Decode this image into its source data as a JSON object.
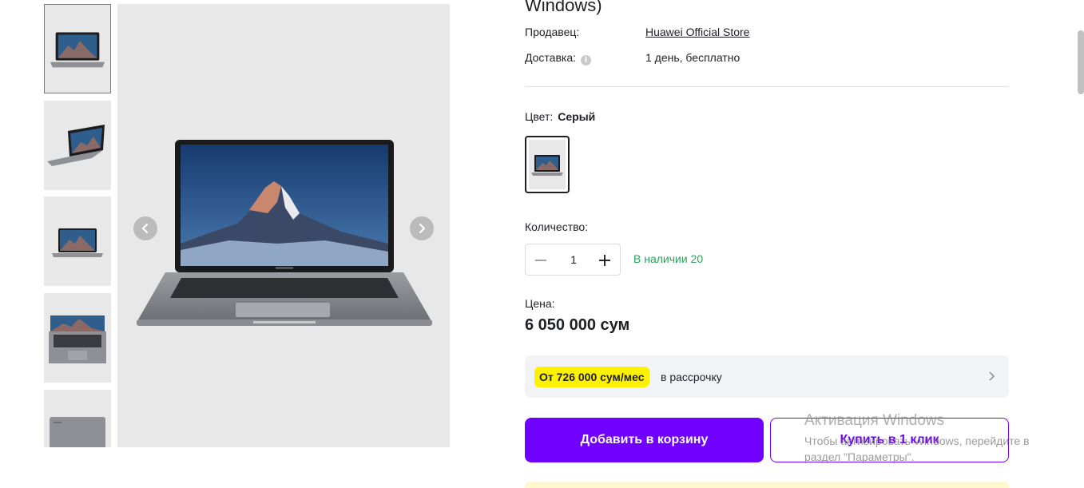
{
  "product": {
    "title_tail": "Windows)"
  },
  "info": {
    "seller_label": "Продавец:",
    "seller_value": "Huawei Official Store",
    "delivery_label": "Доставка:",
    "delivery_value": "1 день, бесплатно",
    "info_icon": "i"
  },
  "color": {
    "label": "Цвет:",
    "value": "Серый"
  },
  "quantity": {
    "label": "Количество:",
    "value": "1",
    "stock": "В наличии 20"
  },
  "price": {
    "label": "Цена:",
    "value": "6 050 000 сум"
  },
  "installment": {
    "badge": "От 726 000 сум/мес",
    "text": "в рассрочку"
  },
  "buttons": {
    "add_to_cart": "Добавить в корзину",
    "buy_one_click": "Купить в 1 клик"
  },
  "watermark": {
    "title": "Активация Windows",
    "text": "Чтобы активировать Windows, перейдите в раздел \"Параметры\"."
  },
  "gallery": {
    "thumb_count": 5,
    "active_index": 0
  },
  "icons": [
    "chevron-left-icon",
    "chevron-right-icon",
    "info-icon",
    "minus-icon",
    "plus-icon",
    "chevron-right-icon"
  ],
  "colors": {
    "accent": "#7000ff",
    "badge": "#fff200",
    "stock": "#29a35b",
    "panel": "#f2f3f6",
    "image_bg": "#e8e8e8"
  }
}
